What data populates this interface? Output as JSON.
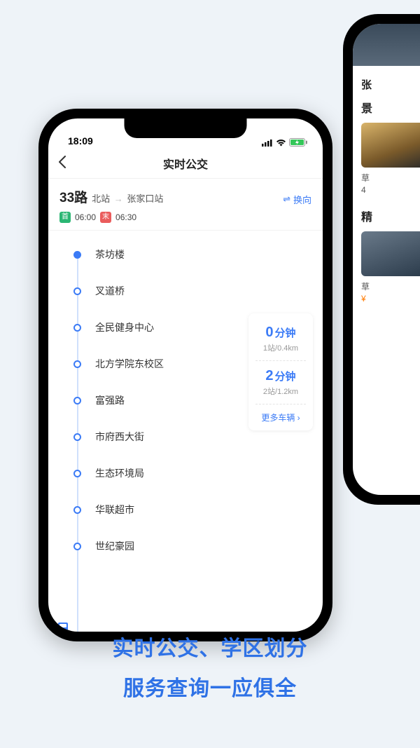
{
  "statusbar": {
    "time": "18:09"
  },
  "nav": {
    "title": "实时公交"
  },
  "route": {
    "number": "33路",
    "from": "北站",
    "to": "张家口站",
    "swap_label": "换向",
    "first_badge": "首",
    "first_time": "06:00",
    "last_badge": "末",
    "last_time": "06:30"
  },
  "stops": [
    {
      "name": "茶坊楼"
    },
    {
      "name": "叉道桥"
    },
    {
      "name": "全民健身中心"
    },
    {
      "name": "北方学院东校区"
    },
    {
      "name": "富强路"
    },
    {
      "name": "市府西大街"
    },
    {
      "name": "生态环境局"
    },
    {
      "name": "华联超市"
    },
    {
      "name": "世纪豪园"
    }
  ],
  "eta": [
    {
      "big": "0",
      "unit": "分钟",
      "sub": "1站/0.4km"
    },
    {
      "big": "2",
      "unit": "分钟",
      "sub": "2站/1.2km"
    }
  ],
  "more_label": "更多车辆",
  "phone2": {
    "title_prefix": "张",
    "section1": "景",
    "cap1": "草",
    "cap1b": "4",
    "section2": "精",
    "cap2": "草",
    "price": "¥"
  },
  "tagline": {
    "l1": "实时公交、学区划分",
    "l2": "服务查询一应俱全"
  }
}
